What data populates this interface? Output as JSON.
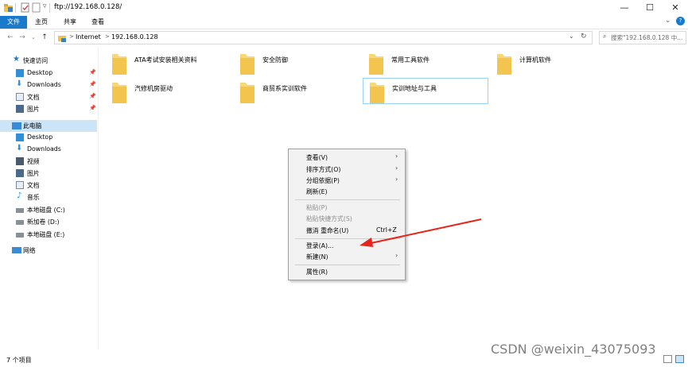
{
  "window": {
    "title": "ftp://192.168.0.128/",
    "minimize_glyph": "—",
    "maximize_glyph": "☐",
    "close_glyph": "✕"
  },
  "ribbon": {
    "tabs": [
      "文件",
      "主页",
      "共享",
      "查看"
    ],
    "active_tab": "文件",
    "accent_color": "#1979ca",
    "expand_glyph": "⌄",
    "help_glyph": "?"
  },
  "address": {
    "segments": [
      "Internet",
      "192.168.0.128"
    ],
    "separator": ">",
    "refresh_glyph": "↻",
    "dropdown_glyph": "⌄"
  },
  "search": {
    "placeholder": "搜索\"192.168.0.128 中..."
  },
  "navigation": {
    "quick_access": "快速访问",
    "quick_items": [
      {
        "label": "Desktop",
        "icon": "desktop-icon"
      },
      {
        "label": "Downloads",
        "icon": "download-icon"
      },
      {
        "label": "文档",
        "icon": "document-icon"
      },
      {
        "label": "图片",
        "icon": "picture-icon"
      }
    ],
    "this_pc": "此电脑",
    "pc_items": [
      {
        "label": "Desktop",
        "icon": "desktop-icon"
      },
      {
        "label": "Downloads",
        "icon": "download-icon"
      },
      {
        "label": "视频",
        "icon": "video-icon"
      },
      {
        "label": "图片",
        "icon": "picture-icon"
      },
      {
        "label": "文档",
        "icon": "document-icon"
      },
      {
        "label": "音乐",
        "icon": "music-icon"
      },
      {
        "label": "本地磁盘 (C:)",
        "icon": "drive-icon"
      },
      {
        "label": "新加卷 (D:)",
        "icon": "drive-icon"
      },
      {
        "label": "本地磁盘 (E:)",
        "icon": "drive-icon"
      }
    ],
    "network": "网络"
  },
  "folders": [
    "ATA考试安装相关资料",
    "安全防御",
    "常用工具软件",
    "计算机软件",
    "汽修机房驱动",
    "商贸系实训软件",
    "实训地址与工具"
  ],
  "context_menu": {
    "items": [
      {
        "label": "查看(V)",
        "submenu": true,
        "disabled": false
      },
      {
        "label": "排序方式(O)",
        "submenu": true,
        "disabled": false
      },
      {
        "label": "分组依据(P)",
        "submenu": true,
        "disabled": false
      },
      {
        "label": "刷新(E)",
        "submenu": false,
        "disabled": false
      },
      {
        "label": "粘贴(P)",
        "submenu": false,
        "disabled": true
      },
      {
        "label": "粘贴快捷方式(S)",
        "submenu": false,
        "disabled": true
      },
      {
        "label": "撤消 重命名(U)",
        "shortcut": "Ctrl+Z",
        "submenu": false,
        "disabled": false
      },
      {
        "label": "登录(A)...",
        "submenu": false,
        "disabled": false
      },
      {
        "label": "新建(N)",
        "submenu": true,
        "disabled": false
      },
      {
        "label": "属性(R)",
        "submenu": false,
        "disabled": false
      }
    ]
  },
  "status_bar": {
    "item_count": "7 个项目"
  },
  "annotation": {
    "color": "#e8231b"
  },
  "watermark": "CSDN @weixin_43075093"
}
